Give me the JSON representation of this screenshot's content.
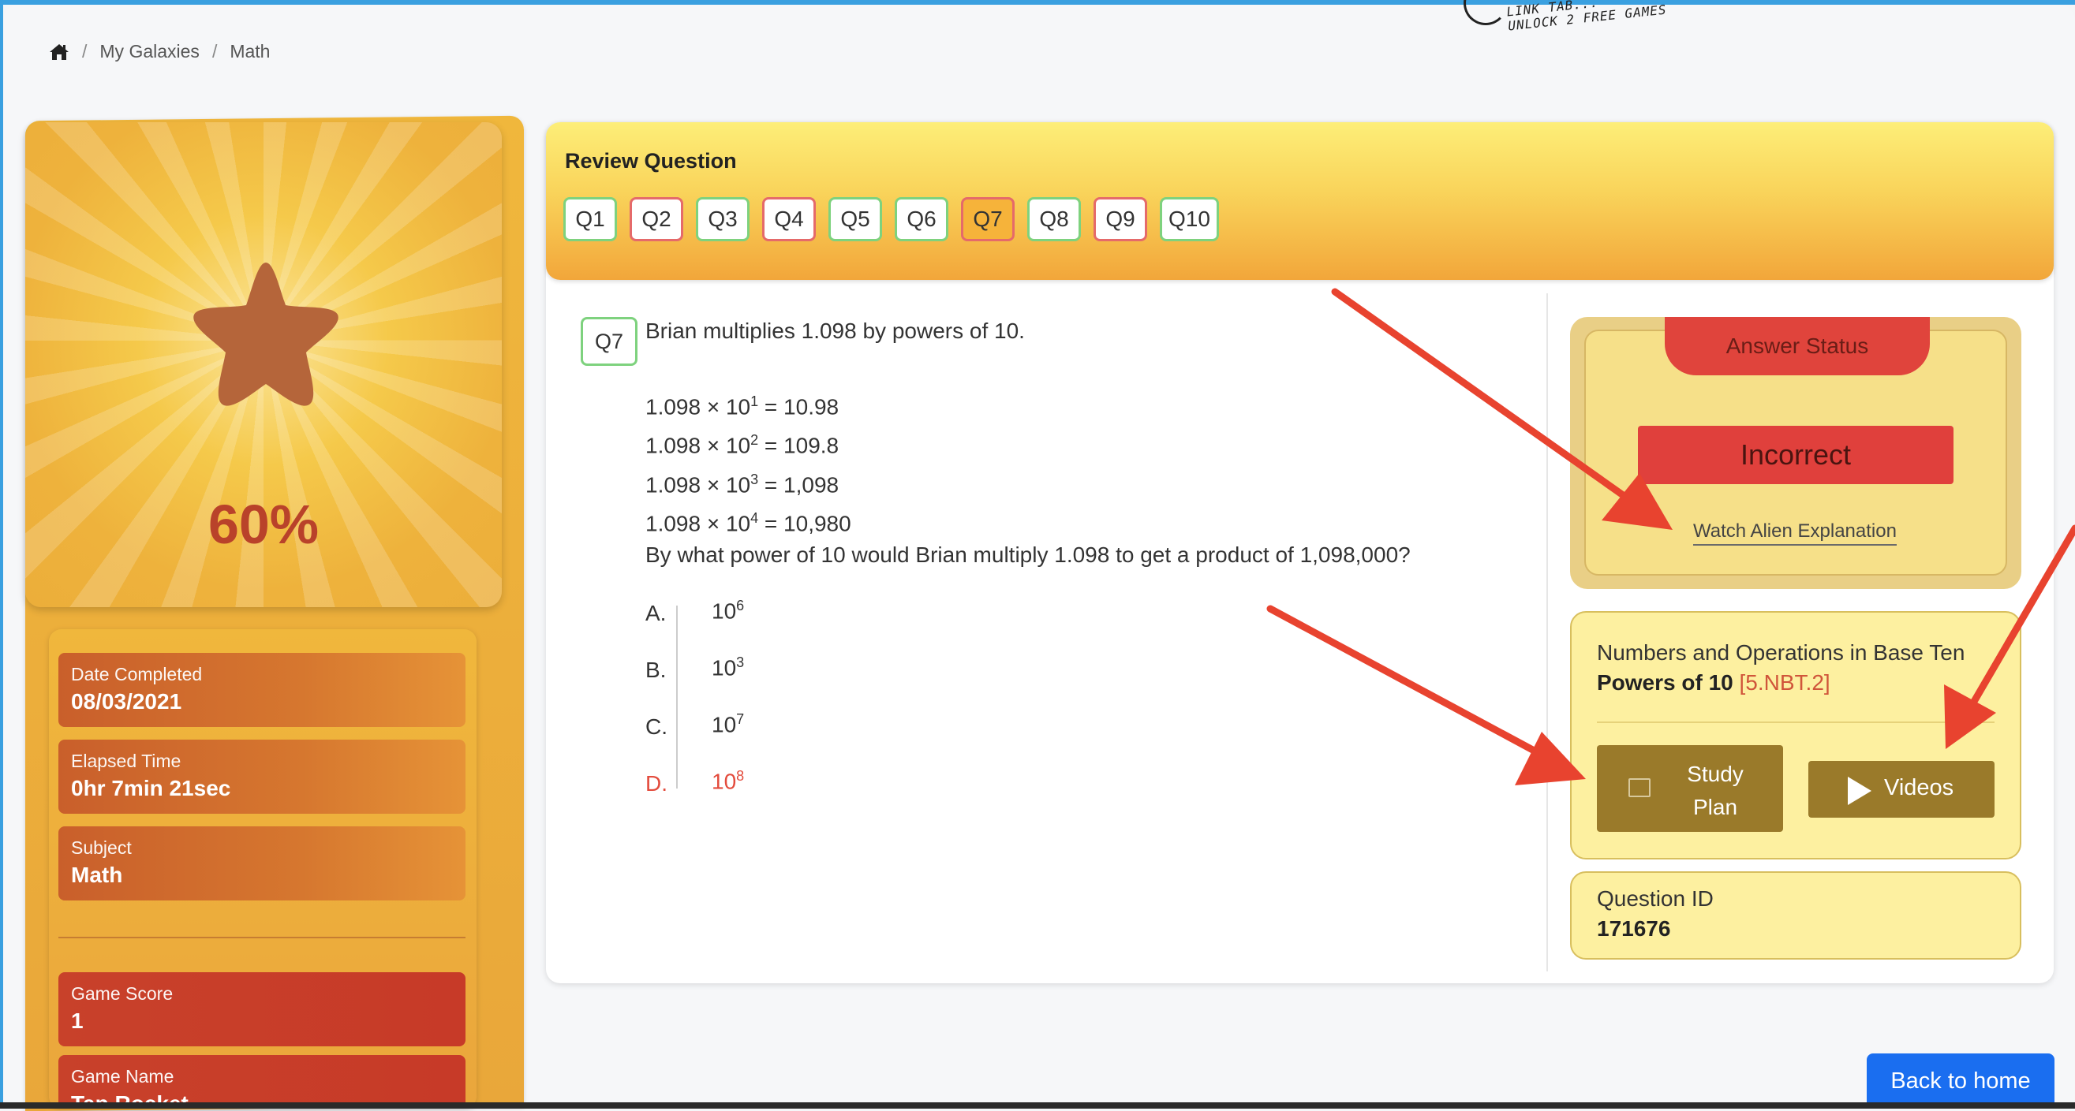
{
  "promo": {
    "line1": "LINK TAB...",
    "line2": "UNLOCK 2 FREE GAMES"
  },
  "breadcrumb": {
    "home_icon": "home-icon",
    "items": [
      "My Galaxies",
      "Math"
    ],
    "separator": "/"
  },
  "score": {
    "percent": "60%",
    "star_icon": "star-icon"
  },
  "stats": {
    "date_label": "Date Completed",
    "date_value": "08/03/2021",
    "elapsed_label": "Elapsed Time",
    "elapsed_value": "0hr 7min 21sec",
    "subject_label": "Subject",
    "subject_value": "Math",
    "score_label": "Game Score",
    "score_value": "1",
    "game_label": "Game Name",
    "game_value": "Tap Rocket"
  },
  "review": {
    "title": "Review Question",
    "tabs": [
      {
        "label": "Q1",
        "status": "correct"
      },
      {
        "label": "Q2",
        "status": "incorrect"
      },
      {
        "label": "Q3",
        "status": "correct"
      },
      {
        "label": "Q4",
        "status": "incorrect"
      },
      {
        "label": "Q5",
        "status": "correct"
      },
      {
        "label": "Q6",
        "status": "correct"
      },
      {
        "label": "Q7",
        "status": "active"
      },
      {
        "label": "Q8",
        "status": "correct"
      },
      {
        "label": "Q9",
        "status": "incorrect"
      },
      {
        "label": "Q10",
        "status": "correct"
      }
    ]
  },
  "question": {
    "badge": "Q7",
    "text": "Brian multiplies 1.098 by powers of 10.",
    "equations": [
      {
        "base": "1.098 × 10",
        "exp": "1",
        "result": " = 10.98"
      },
      {
        "base": "1.098 × 10",
        "exp": "2",
        "result": " = 109.8"
      },
      {
        "base": "1.098 × 10",
        "exp": "3",
        "result": " = 1,098"
      },
      {
        "base": "1.098 × 10",
        "exp": "4",
        "result": " = 10,980"
      }
    ],
    "prompt": "By what power of 10 would Brian multiply 1.098 to get a product of 1,098,000?",
    "choices": [
      {
        "letter": "A.",
        "base": "10",
        "exp": "6"
      },
      {
        "letter": "B.",
        "base": "10",
        "exp": "3"
      },
      {
        "letter": "C.",
        "base": "10",
        "exp": "7"
      },
      {
        "letter": "D.",
        "base": "10",
        "exp": "8"
      }
    ]
  },
  "answer": {
    "status_title": "Answer Status",
    "result": "Incorrect",
    "watch_link": "Watch Alien Explanation"
  },
  "standard": {
    "domain": "Numbers and Operations in Base Ten",
    "topic": "Powers of 10",
    "code": "[5.NBT.2]",
    "study_label_1": "Study",
    "study_label_2": "Plan",
    "videos_label": "Videos"
  },
  "question_id": {
    "label": "Question ID",
    "value": "171676"
  },
  "back_button": "Back to home",
  "colors": {
    "correct": "#7ed27e",
    "incorrect": "#e56a6a",
    "accent": "#1a6ef0",
    "arrow": "#e8432f"
  }
}
